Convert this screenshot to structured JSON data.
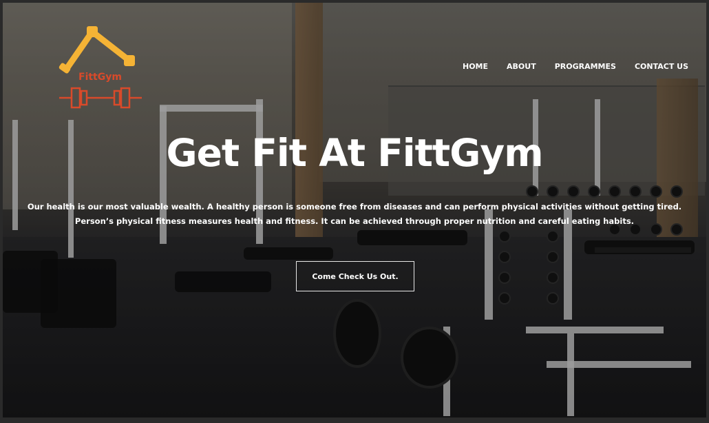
{
  "brand": {
    "name": "FittGym"
  },
  "nav": {
    "items": [
      {
        "label": "HOME"
      },
      {
        "label": "ABOUT"
      },
      {
        "label": "PROGRAMMES"
      },
      {
        "label": "CONTACT US"
      }
    ]
  },
  "hero": {
    "title": "Get Fit At FittGym",
    "line1": "Our health is our most valuable wealth. A healthy person is someone free from diseases and can perform physical activities without getting tired.",
    "line2": "Person’s physical fitness measures health and fitness. It can be achieved through proper nutrition and careful eating habits.",
    "cta_label": "Come Check Us Out."
  },
  "colors": {
    "logo_primary": "#f5b335",
    "logo_accent": "#d94a2a",
    "text": "#ffffff"
  },
  "icons": {
    "logo": "dumbbell-logo-icon"
  }
}
